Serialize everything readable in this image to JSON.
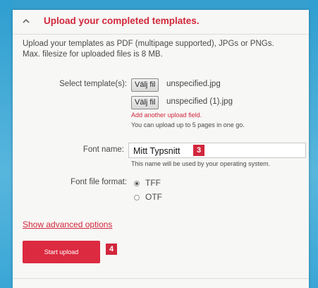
{
  "header": {
    "title": "Upload your completed templates.",
    "chevron_icon": "chevron-up-icon"
  },
  "intro": {
    "line1": "Upload your templates as PDF (multipage supported), JPGs or PNGs.",
    "line2": "Max. filesize for uploaded files is 8 MB."
  },
  "templates": {
    "label": "Select template(s):",
    "files": [
      {
        "button": "Välj fil",
        "filename": "unspecified.jpg"
      },
      {
        "button": "Välj fil",
        "filename": "unspecified (1).jpg"
      }
    ],
    "add_link": "Add another upload field.",
    "limit_note": "You can upload up to 5 pages in one go."
  },
  "font_name": {
    "label": "Font name:",
    "value": "Mitt Typsnitt",
    "hint": "This name will be used by your operating system.",
    "badge": "3"
  },
  "font_format": {
    "label": "Font file format:",
    "options": [
      {
        "label": "TFF",
        "selected": true
      },
      {
        "label": "OTF",
        "selected": false
      }
    ]
  },
  "advanced_link": "Show advanced options",
  "upload": {
    "button": "Start upload",
    "badge": "4"
  },
  "colors": {
    "accent": "#d1273b",
    "background": "#35a0cf",
    "panel": "#f7f7f5"
  }
}
